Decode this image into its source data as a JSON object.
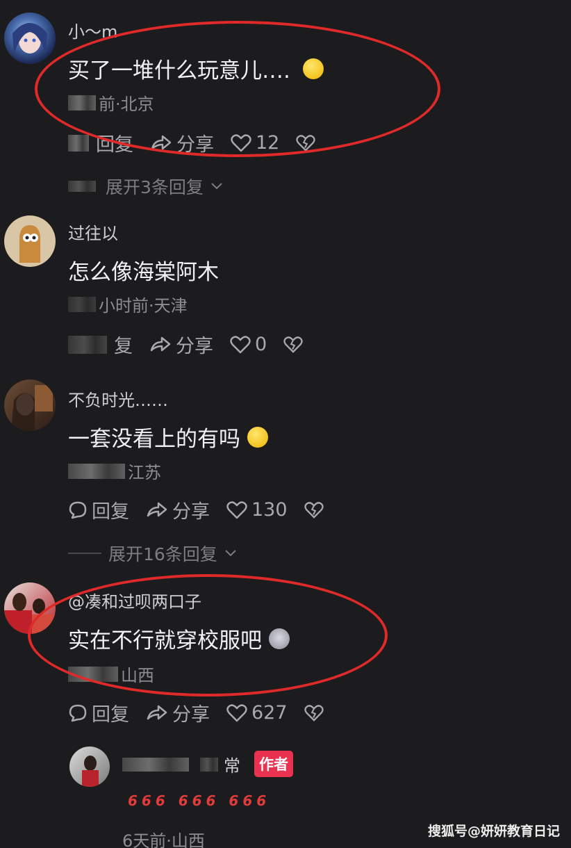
{
  "comments": [
    {
      "username": "小～m",
      "text": "买了一堆什么玩意儿….",
      "meta": "前·北京",
      "reply_label": "回复",
      "share_label": "分享",
      "likes": "12",
      "expand_label": "展开3条回复"
    },
    {
      "username": "过往以",
      "text": "怎么像海棠阿木",
      "meta": "小时前·天津",
      "reply_label": "复",
      "share_label": "分享",
      "likes": "0"
    },
    {
      "username": "不负时光……",
      "text": "一套没看上的有吗",
      "meta": "江苏",
      "reply_label": "回复",
      "share_label": "分享",
      "likes": "130",
      "expand_label": "展开16条回复"
    },
    {
      "username": "@凑和过呗两口子",
      "text": "实在不行就穿校服吧",
      "meta": "山西",
      "reply_label": "回复",
      "share_label": "分享",
      "likes": "627"
    }
  ],
  "reply": {
    "username_suffix": "常",
    "author_badge": "作者",
    "text": "666 666 666",
    "meta": "6天前·山西"
  },
  "watermark": "搜狐号@妍妍教育日记",
  "colors": {
    "background": "#1c1c1e",
    "annotation_ring": "#e02a2a",
    "author_badge": "#e8324f"
  }
}
